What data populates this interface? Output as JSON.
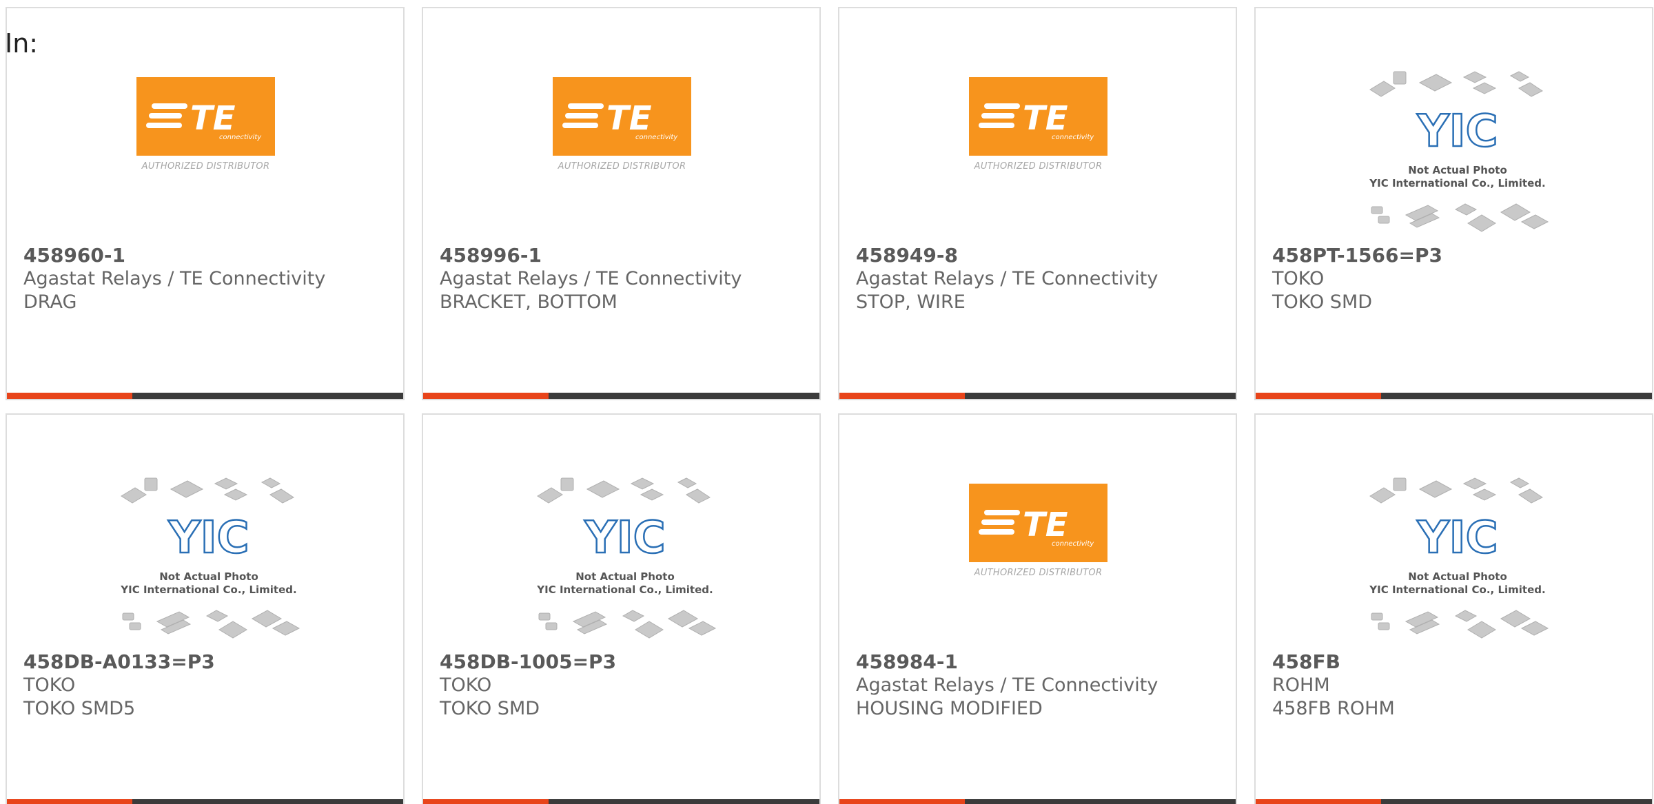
{
  "header": {
    "label": "In:"
  },
  "colors": {
    "accent": "#e8441a",
    "bar": "#3b3b3b",
    "te_orange": "#f7941d",
    "yic_blue": "#2a6fb5"
  },
  "placeholders": {
    "te": {
      "logo_text": "TE",
      "logo_sub": "connectivity",
      "caption": "AUTHORIZED DISTRIBUTOR"
    },
    "yic": {
      "logo_text": "YIC",
      "caption_line1": "Not Actual Photo",
      "caption_line2": "YIC International Co., Limited."
    }
  },
  "products": [
    {
      "image": "te-logo",
      "part_number": "458960-1",
      "manufacturer": "Agastat Relays / TE Connectivity",
      "description": "DRAG"
    },
    {
      "image": "te-logo",
      "part_number": "458996-1",
      "manufacturer": "Agastat Relays / TE Connectivity",
      "description": "BRACKET, BOTTOM"
    },
    {
      "image": "te-logo",
      "part_number": "458949-8",
      "manufacturer": "Agastat Relays / TE Connectivity",
      "description": "STOP, WIRE"
    },
    {
      "image": "yic-placeholder",
      "part_number": "458PT-1566=P3",
      "manufacturer": "TOKO",
      "description": "TOKO SMD"
    },
    {
      "image": "yic-placeholder",
      "part_number": "458DB-A0133=P3",
      "manufacturer": "TOKO",
      "description": "TOKO SMD5"
    },
    {
      "image": "yic-placeholder",
      "part_number": "458DB-1005=P3",
      "manufacturer": "TOKO",
      "description": "TOKO SMD"
    },
    {
      "image": "te-logo",
      "part_number": "458984-1",
      "manufacturer": "Agastat Relays / TE Connectivity",
      "description": "HOUSING MODIFIED"
    },
    {
      "image": "yic-placeholder",
      "part_number": "458FB",
      "manufacturer": "ROHM",
      "description": "458FB ROHM"
    }
  ]
}
